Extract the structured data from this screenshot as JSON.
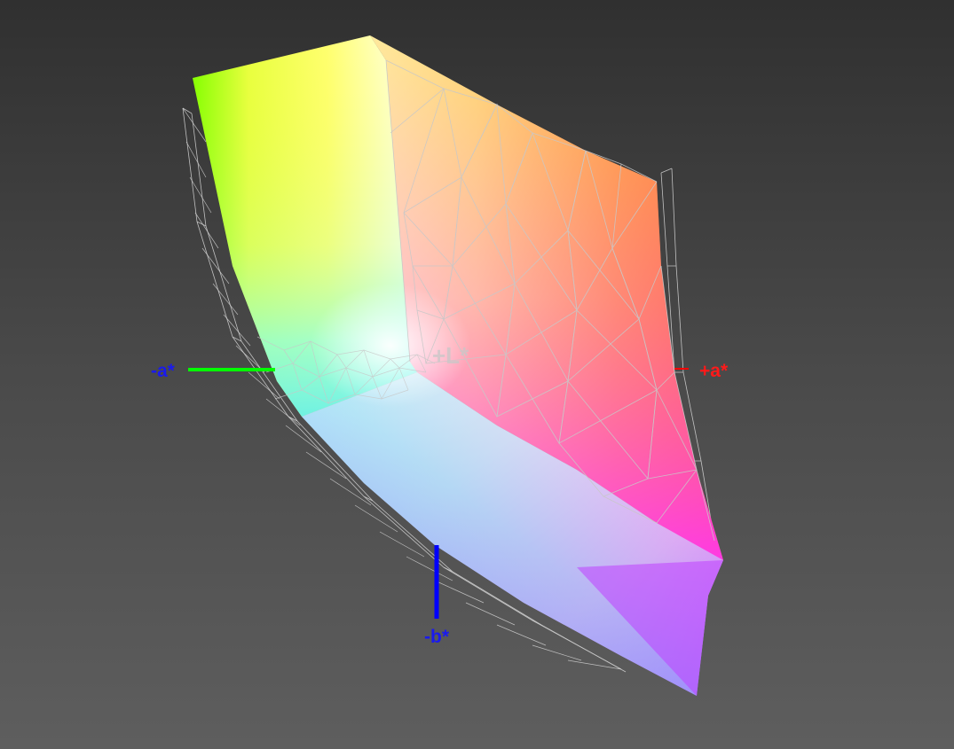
{
  "axes": {
    "neg_a": {
      "label": "-a*",
      "color": "#1a1aee",
      "line_color": "#00ff00"
    },
    "pos_a": {
      "label": "+a*",
      "color": "#ff1a1a",
      "line_color": "#ff0000"
    },
    "neg_b": {
      "label": "-b*",
      "color": "#1a1aee",
      "line_color": "#0000ff"
    },
    "pos_l": {
      "label": "+L*",
      "color": "#c8c8c8"
    }
  },
  "colors": {
    "background_top": "#303030",
    "background_bottom": "#5e5e5e",
    "wireframe": "#d8d8d8",
    "gamut_yellow": "#ffff00",
    "gamut_green": "#80ff00",
    "gamut_orange": "#ff8040",
    "gamut_red": "#ff4080",
    "gamut_magenta": "#ff40ff",
    "gamut_violet": "#a020ff",
    "gamut_blue": "#8080ff",
    "gamut_cyan": "#60f0f0",
    "gamut_white": "#ffffe8"
  }
}
